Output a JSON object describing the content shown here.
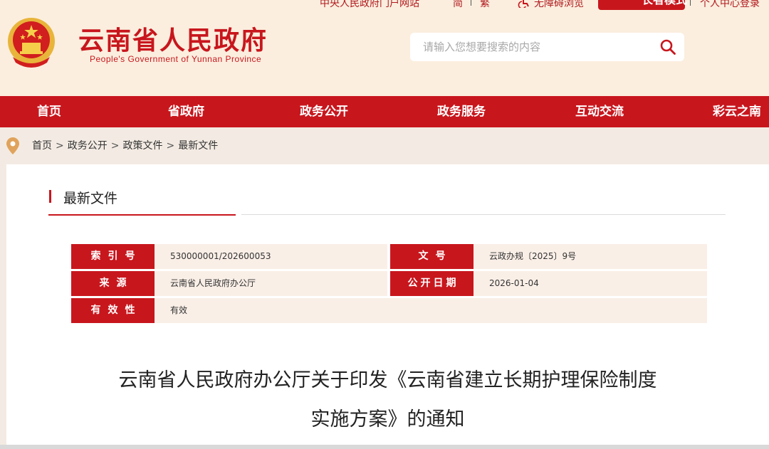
{
  "top_links": {
    "central_portal": "中央人民政府门户网站",
    "simplified": "简",
    "traditional": "繁",
    "accessibility": "无障碍浏览",
    "elder_mode": "长者模式",
    "personal_center": "个人中心登录"
  },
  "header": {
    "title": "云南省人民政府",
    "subtitle": "People's Government of Yunnan Province",
    "emblem_icon": "national-emblem-icon"
  },
  "search": {
    "placeholder": "请输入您想要搜索的内容",
    "icon": "search-icon"
  },
  "nav": {
    "items": [
      "首页",
      "省政府",
      "政务公开",
      "政务服务",
      "互动交流",
      "彩云之南"
    ]
  },
  "breadcrumb": {
    "items": [
      "首页",
      "政务公开",
      "政策文件",
      "最新文件"
    ],
    "separator": ">",
    "icon": "location-pin-icon"
  },
  "section": {
    "title": "最新文件"
  },
  "meta": {
    "index_label": "索引号",
    "index_value": "530000001/202600053",
    "doc_no_label": "文号",
    "doc_no_value": "云政办规〔2025〕9号",
    "source_label": "来源",
    "source_value": "云南省人民政府办公厅",
    "date_label": "公开日期",
    "date_value": "2026-01-04",
    "validity_label": "有效性",
    "validity_value": "有效"
  },
  "document": {
    "title_line1": "云南省人民政府办公厅关于印发《云南省建立长期护理保险制度",
    "title_line2": "实施方案》的通知"
  },
  "colors": {
    "brand_red": "#c8161d",
    "header_bg": "#fbeede",
    "meta_value_bg": "#faefe7"
  }
}
